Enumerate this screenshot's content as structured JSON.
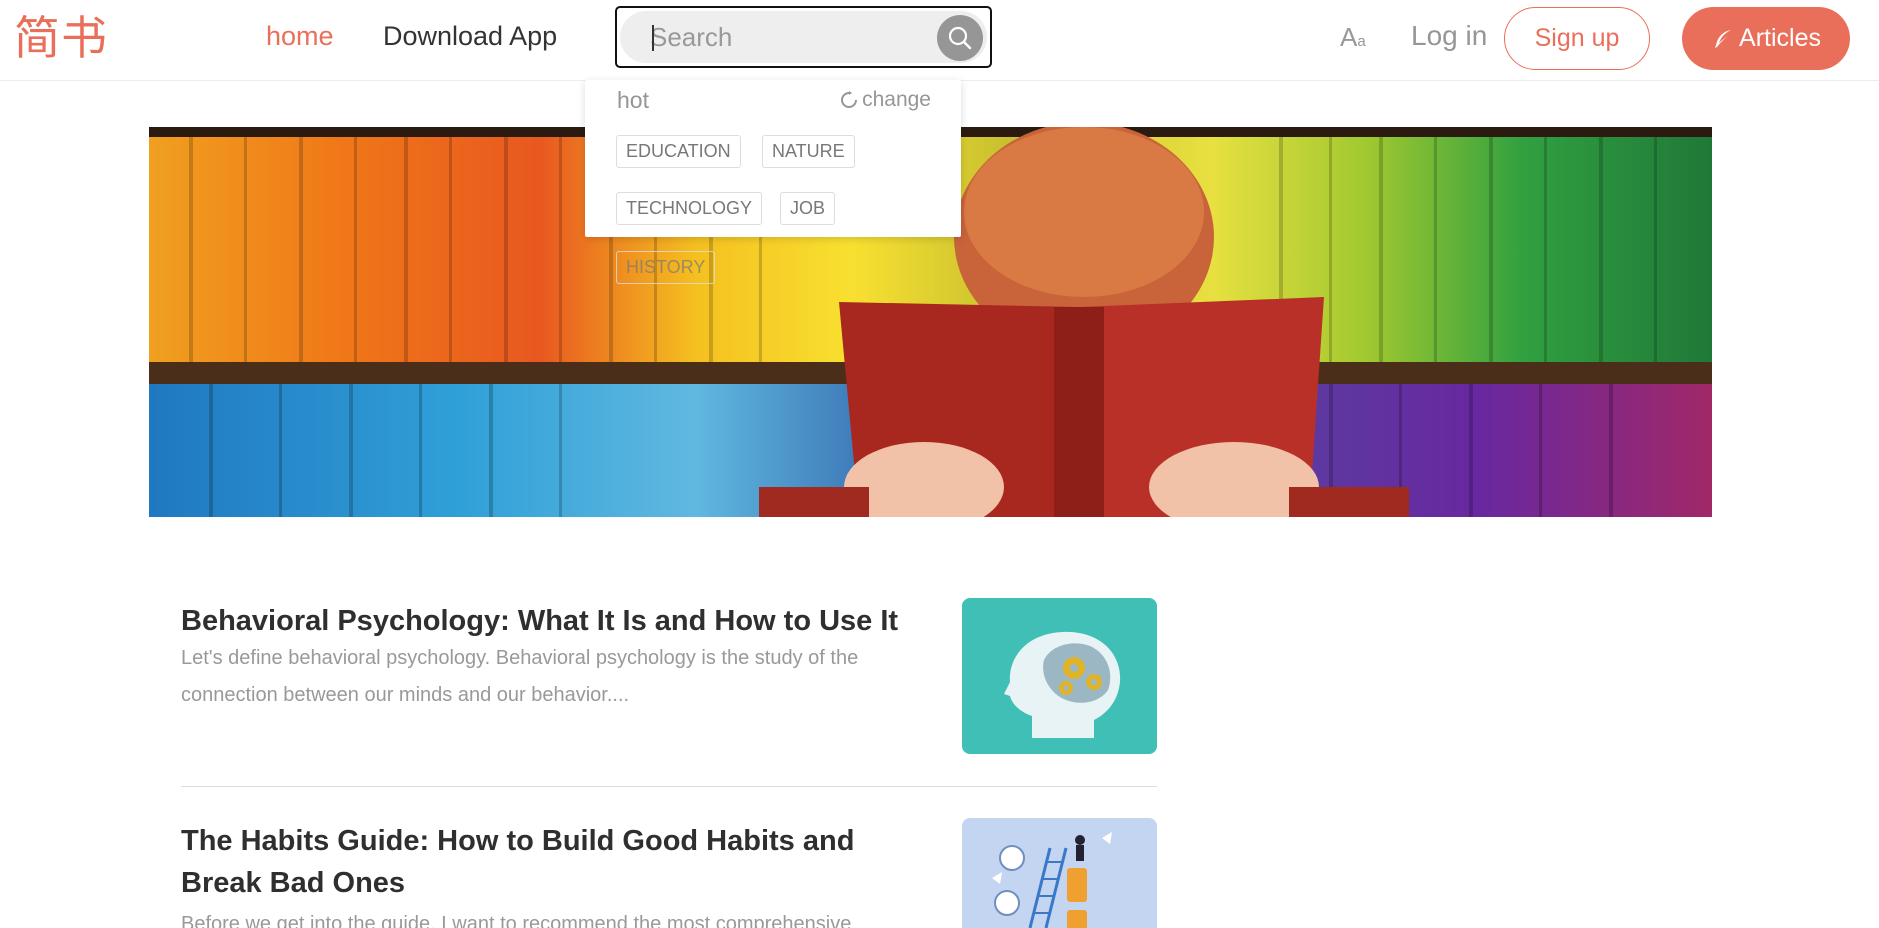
{
  "header": {
    "logo": "简书",
    "nav": {
      "home": "home",
      "download": "Download App"
    },
    "search": {
      "placeholder": "Search",
      "value": ""
    },
    "font_toggle_big": "A",
    "font_toggle_small": "a",
    "login": "Log in",
    "signup": "Sign up",
    "write": "Articles"
  },
  "hot_panel": {
    "title": "hot",
    "change": "change",
    "tags": [
      "EDUCATION",
      "NATURE",
      "TECHNOLOGY",
      "JOB",
      "HISTORY"
    ]
  },
  "banner": {
    "icon": "reading-person-bookshelf-image"
  },
  "articles": [
    {
      "title": "Behavioral Psychology: What It Is and How to Use It",
      "abstract_line1": "Let's define behavioral psychology. Behavioral psychology is the study of the",
      "abstract_line2": "connection between our minds and our behavior....",
      "thumb_icon": "brain-gears-head-icon"
    },
    {
      "title_line1": "The Habits Guide: How to Build Good Habits and",
      "title_line2": "Break Bad Ones",
      "abstract_line1": "Before we get into the guide, I want to recommend the most comprehensive",
      "thumb_icon": "habits-ladder-illustration"
    }
  ],
  "colors": {
    "brand": "#ea6f5a",
    "text": "#333333",
    "muted": "#969696",
    "thumb1_bg": "#40bfb7",
    "thumb2_bg": "#c4d5f2"
  }
}
